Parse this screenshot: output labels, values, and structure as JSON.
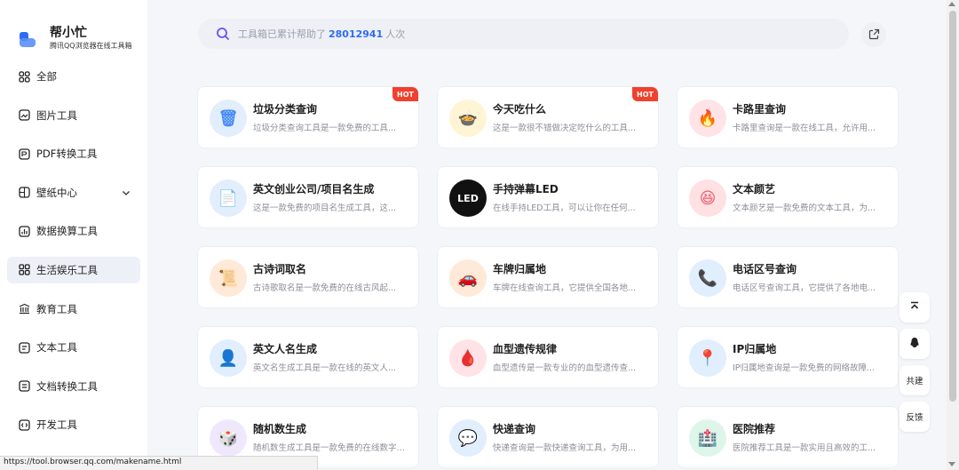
{
  "brand": {
    "name": "帮小忙",
    "subtitle": "腾讯QQ浏览器在线工具箱"
  },
  "nav": [
    {
      "label": "全部",
      "icon": "grid-icon"
    },
    {
      "label": "图片工具",
      "icon": "image-icon"
    },
    {
      "label": "PDF转换工具",
      "icon": "pdf-icon"
    },
    {
      "label": "壁纸中心",
      "icon": "wallpaper-icon"
    },
    {
      "label": "数据换算工具",
      "icon": "chart-icon"
    },
    {
      "label": "生活娱乐工具",
      "icon": "life-icon"
    },
    {
      "label": "教育工具",
      "icon": "education-icon"
    },
    {
      "label": "文本工具",
      "icon": "text-icon"
    },
    {
      "label": "文档转换工具",
      "icon": "doc-icon"
    },
    {
      "label": "开发工具",
      "icon": "code-icon"
    }
  ],
  "search": {
    "prefix": "工具箱已累计帮助了",
    "count": "28012941",
    "suffix": "人次"
  },
  "cards": [
    {
      "title": "垃圾分类查询",
      "desc": "垃圾分类查询工具是一款免费的工具...",
      "hot": "HOT",
      "icon": "trash-icon",
      "color": "#4a8df5",
      "bg": "#e3eefd",
      "glyph": "🗑"
    },
    {
      "title": "今天吃什么",
      "desc": "这是一款很不错做决定吃什么的工具...",
      "hot": "HOT",
      "icon": "food-icon",
      "color": "#f4b81d",
      "bg": "#fff4d4",
      "glyph": "🍲"
    },
    {
      "title": "卡路里查询",
      "desc": "卡路里查询是一款在线工具，允许用...",
      "hot": "",
      "icon": "flame-icon",
      "color": "#f2566a",
      "bg": "#ffe3e6",
      "glyph": "🔥"
    },
    {
      "title": "英文创业公司/项目名生成",
      "desc": "这是一款免费的项目名生成工具，这...",
      "hot": "",
      "icon": "project-icon",
      "color": "#4a8df5",
      "bg": "#e3eefd",
      "glyph": "📄"
    },
    {
      "title": "手持弹幕LED",
      "desc": "在线手持LED工具，可以让你在任何...",
      "hot": "",
      "icon": "led-icon",
      "color": "#111111",
      "bg": "#111111",
      "glyph": "LED"
    },
    {
      "title": "文本颜艺",
      "desc": "文本颜艺是一款免费的文本工具，为...",
      "hot": "",
      "icon": "emoji-icon",
      "color": "#ef5d6b",
      "bg": "#ffe0e3",
      "glyph": "😆"
    },
    {
      "title": "古诗词取名",
      "desc": "古诗歌取名是一款免费的在线古风起...",
      "hot": "",
      "icon": "poem-icon",
      "color": "#f07a2c",
      "bg": "#ffe9d9",
      "glyph": "📜"
    },
    {
      "title": "车牌归属地",
      "desc": "车牌在线查询工具，它提供全国各地...",
      "hot": "",
      "icon": "car-icon",
      "color": "#f07a2c",
      "bg": "#ffe9d9",
      "glyph": "🚗"
    },
    {
      "title": "电话区号查询",
      "desc": "电话区号查询工具，它提供了各地电...",
      "hot": "",
      "icon": "phone-icon",
      "color": "#2f86f0",
      "bg": "#e0eefd",
      "glyph": "📞"
    },
    {
      "title": "英文人名生成",
      "desc": "英文名生成工具是一款在线的英文人...",
      "hot": "",
      "icon": "person-icon",
      "color": "#2f86f0",
      "bg": "#e0eefd",
      "glyph": "👤"
    },
    {
      "title": "血型遗传规律",
      "desc": "血型遗传是一款专业的的血型遗传查...",
      "hot": "",
      "icon": "blood-icon",
      "color": "#ef5d6b",
      "bg": "#ffe3e6",
      "glyph": "🩸"
    },
    {
      "title": "IP归属地",
      "desc": "IP归属地查询是一款免费的网络故障...",
      "hot": "",
      "icon": "location-icon",
      "color": "#2f86f0",
      "bg": "#e0eefd",
      "glyph": "📍"
    },
    {
      "title": "随机数生成",
      "desc": "随机数生成工具是一款免费的在线数字生...",
      "hot": "",
      "icon": "dice-icon",
      "color": "#9b7cf2",
      "bg": "#efe8fd",
      "glyph": "🎲"
    },
    {
      "title": "快递查询",
      "desc": "快递查询是一款快递查询工具，为用...",
      "hot": "",
      "icon": "express-icon",
      "color": "#2f86f0",
      "bg": "#e0eefd",
      "glyph": "💬"
    },
    {
      "title": "医院推荐",
      "desc": "医院推荐工具是一款实用且高效的工...",
      "hot": "",
      "icon": "hospital-icon",
      "color": "#21b36a",
      "bg": "#def6e9",
      "glyph": "🏥"
    }
  ],
  "float": {
    "top_label": "",
    "qq_label": "",
    "build_label": "共建",
    "feedback_label": "反馈"
  },
  "status_url": "https://tool.browser.qq.com/makename.html",
  "colors": {
    "accent": "#2d6cf6",
    "hot": "#f0412e",
    "active_nav": "#eef0f8"
  }
}
